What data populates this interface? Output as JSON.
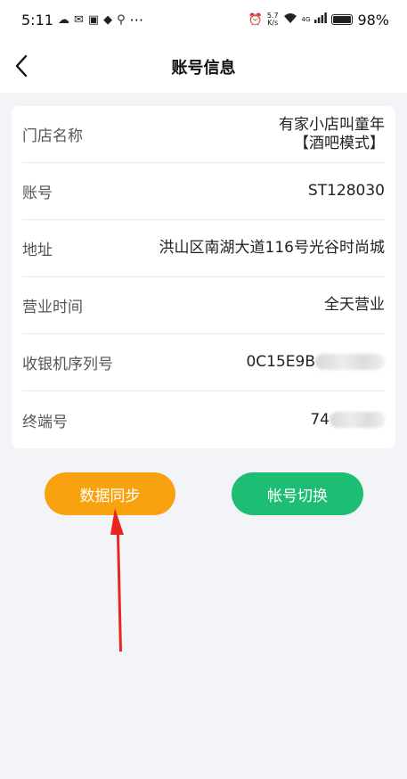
{
  "status_bar": {
    "time": "5:11",
    "more": "···",
    "net_speed_top": "5.7",
    "net_speed_bottom": "K/s",
    "network": "4G",
    "battery": "98%"
  },
  "nav": {
    "title": "账号信息"
  },
  "info": {
    "rows": [
      {
        "label": "门店名称",
        "value_line1": "有家小店叫童年",
        "value_line2": "【酒吧模式】"
      },
      {
        "label": "账号",
        "value": "ST128030"
      },
      {
        "label": "地址",
        "value": "洪山区南湖大道116号光谷时尚城"
      },
      {
        "label": "营业时间",
        "value": "全天营业"
      },
      {
        "label": "收银机序列号",
        "value": "0C15E9B"
      },
      {
        "label": "终端号",
        "value": "74"
      }
    ]
  },
  "actions": {
    "sync_label": "数据同步",
    "switch_label": "帐号切换"
  },
  "colors": {
    "sync_button": "#f9a20f",
    "switch_button": "#1dbe73",
    "annotation_arrow": "#e8251f"
  }
}
